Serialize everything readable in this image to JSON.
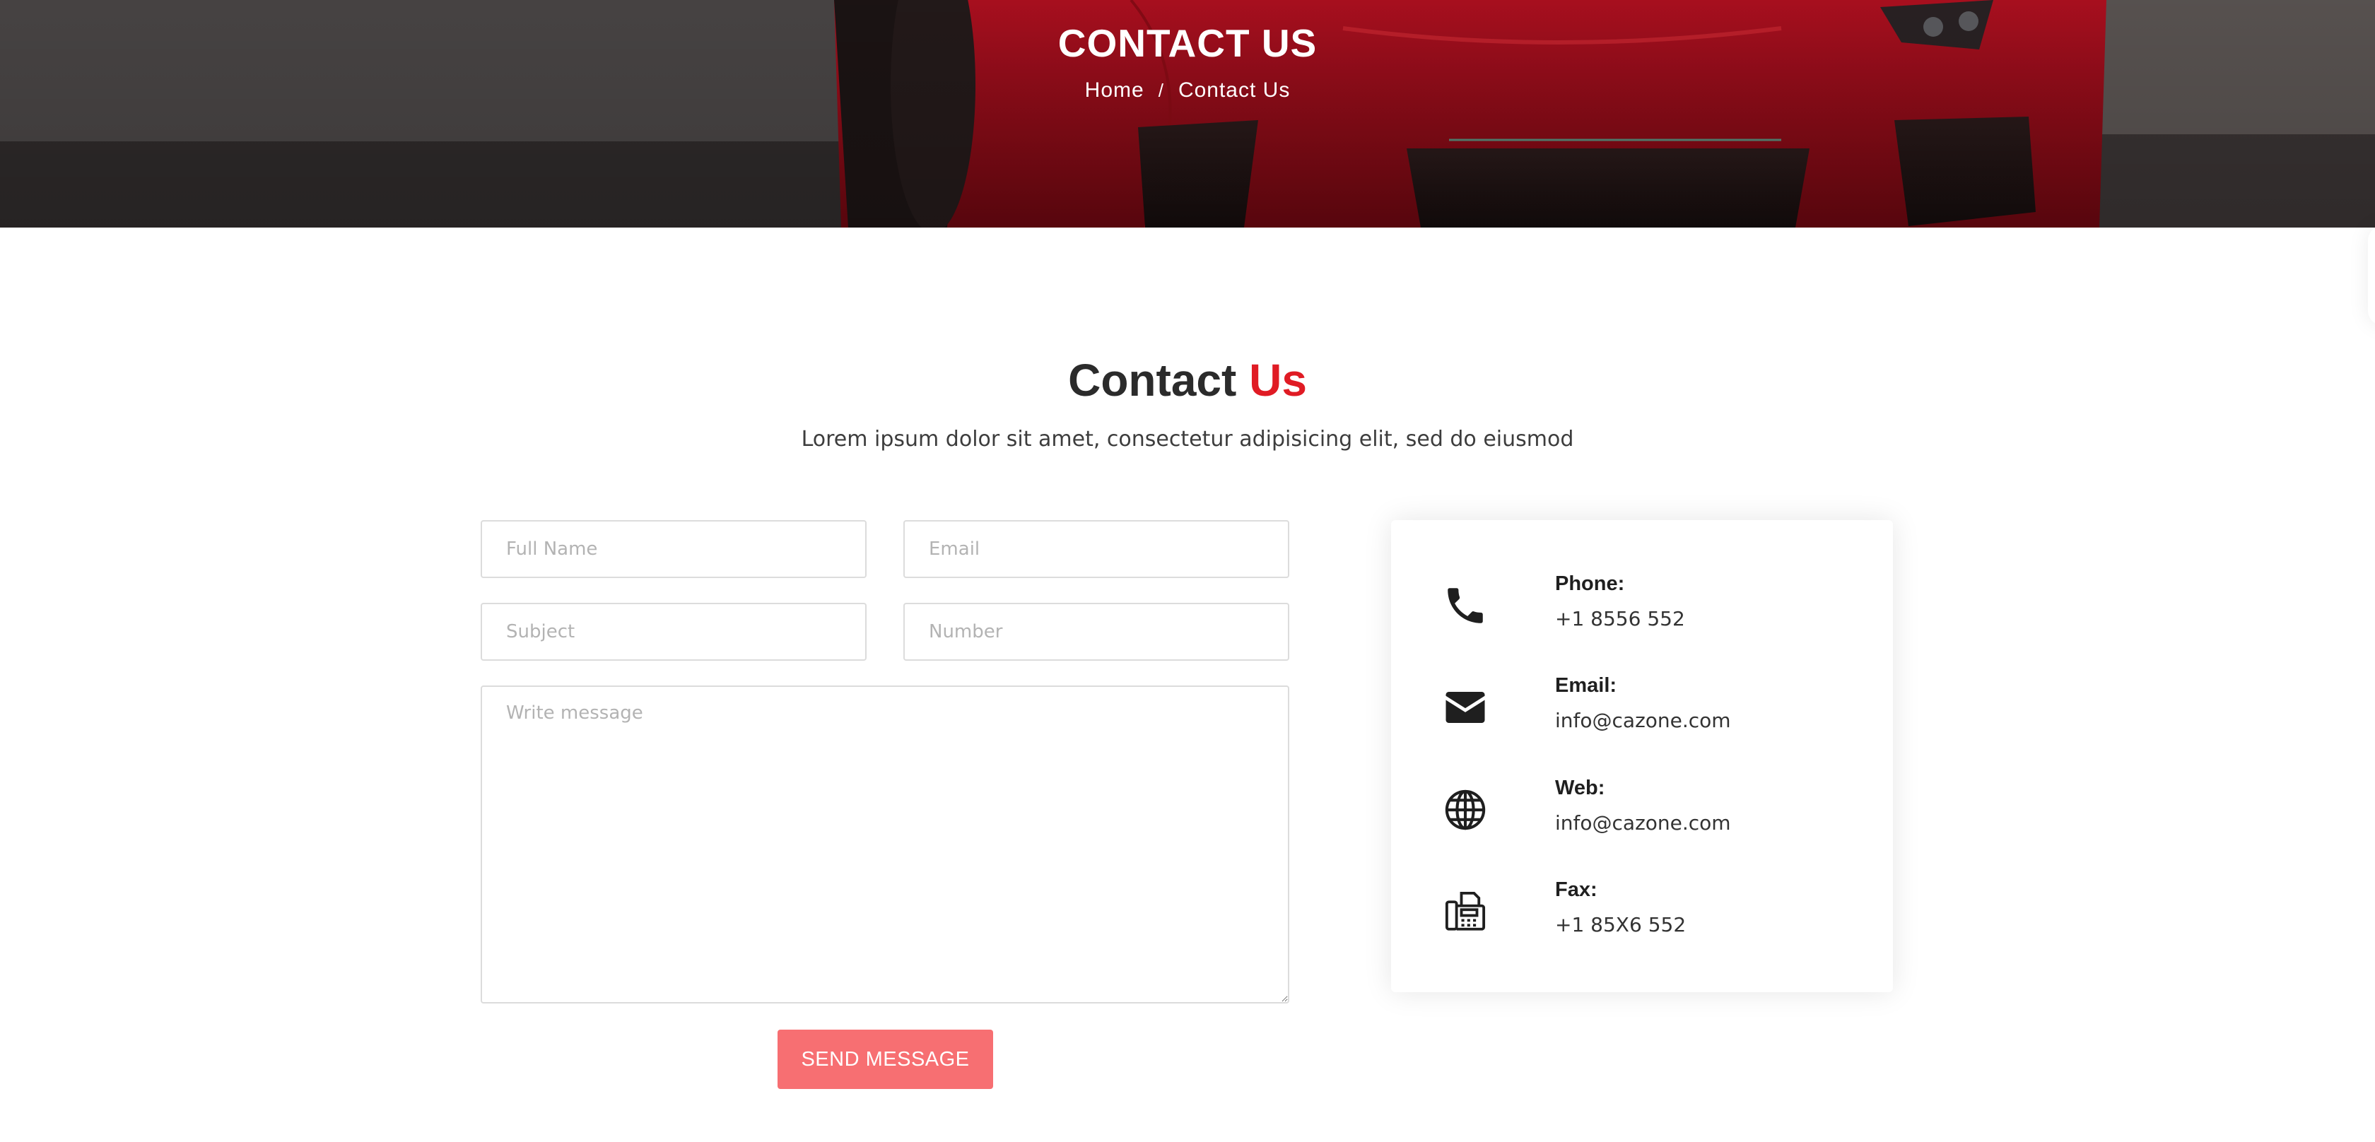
{
  "hero": {
    "title": "CONTACT US",
    "breadcrumb": {
      "home": "Home",
      "separator": "/",
      "current": "Contact Us"
    }
  },
  "section": {
    "title_main": "Contact",
    "title_accent": "Us",
    "subtitle": "Lorem ipsum dolor sit amet, consectetur adipisicing elit, sed do eiusmod"
  },
  "form": {
    "full_name_placeholder": "Full Name",
    "email_placeholder": "Email",
    "subject_placeholder": "Subject",
    "number_placeholder": "Number",
    "message_placeholder": "Write message",
    "submit_label": "SEND MESSAGE"
  },
  "contact_info": {
    "items": [
      {
        "icon": "phone-icon",
        "label": "Phone:",
        "value": "+1 8556 552"
      },
      {
        "icon": "envelope-icon",
        "label": "Email:",
        "value": "info@cazone.com"
      },
      {
        "icon": "globe-icon",
        "label": "Web:",
        "value": "info@cazone.com"
      },
      {
        "icon": "fax-icon",
        "label": "Fax:",
        "value": "+1 85X6 552"
      }
    ]
  },
  "colors": {
    "accent": "#e01b24",
    "button": "#f76f72",
    "heading": "#2b2b2b",
    "text": "#3d3d3d"
  }
}
